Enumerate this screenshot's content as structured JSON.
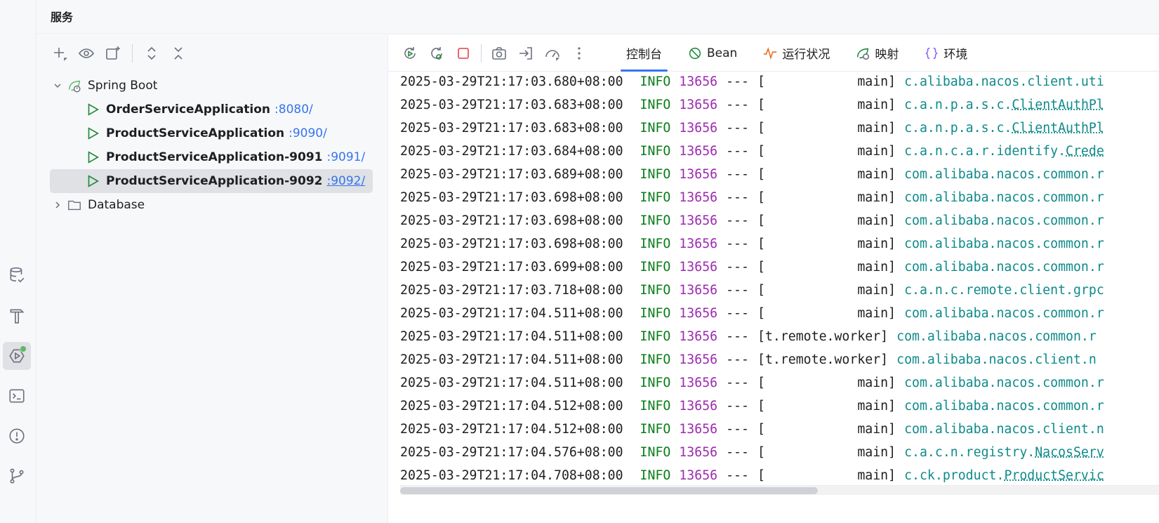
{
  "header": {
    "title": "服务"
  },
  "strip": {
    "icons": [
      "database-check-icon",
      "build-hammer-icon",
      "services-icon",
      "terminal-icon",
      "problems-icon",
      "git-branch-icon"
    ]
  },
  "tree_toolbar": {
    "icons": [
      "add-icon",
      "eye-icon",
      "new-group-icon",
      "expand-all-icon",
      "collapse-all-icon"
    ]
  },
  "tree": {
    "spring_boot": {
      "label": "Spring Boot"
    },
    "apps": [
      {
        "name": "OrderServiceApplication",
        "port": ":8080/"
      },
      {
        "name": "ProductServiceApplication",
        "port": ":9090/"
      },
      {
        "name": "ProductServiceApplication-9091",
        "port": ":9091/"
      },
      {
        "name": "ProductServiceApplication-9092",
        "port": ":9092/"
      }
    ],
    "database": {
      "label": "Database"
    }
  },
  "console_toolbar": {
    "icons": [
      "rerun-icon",
      "rerun-debug-icon",
      "stop-icon",
      "screenshot-icon",
      "attach-icon",
      "profiler-icon",
      "more-vertical-icon"
    ]
  },
  "tabs": [
    {
      "label": "控制台",
      "icon": ""
    },
    {
      "label": "Bean",
      "icon": "bean-icon"
    },
    {
      "label": "运行状况",
      "icon": "health-icon"
    },
    {
      "label": "映射",
      "icon": "mapping-icon"
    },
    {
      "label": "环境",
      "icon": "environment-icon"
    }
  ],
  "log": {
    "level": "INFO",
    "pid": "13656",
    "separator": "---",
    "lines": [
      {
        "ts": "2025-03-29T21:17:03.680+08:00",
        "thread": "[            main]",
        "logger": "c.alibaba.nacos.client.uti",
        "link": ""
      },
      {
        "ts": "2025-03-29T21:17:03.683+08:00",
        "thread": "[            main]",
        "logger": "c.a.n.p.a.s.c.",
        "link": "ClientAuthPl"
      },
      {
        "ts": "2025-03-29T21:17:03.683+08:00",
        "thread": "[            main]",
        "logger": "c.a.n.p.a.s.c.",
        "link": "ClientAuthPl"
      },
      {
        "ts": "2025-03-29T21:17:03.684+08:00",
        "thread": "[            main]",
        "logger": "c.a.n.c.a.r.identify.",
        "link": "Crede"
      },
      {
        "ts": "2025-03-29T21:17:03.689+08:00",
        "thread": "[            main]",
        "logger": "com.alibaba.nacos.common.r",
        "link": ""
      },
      {
        "ts": "2025-03-29T21:17:03.698+08:00",
        "thread": "[            main]",
        "logger": "com.alibaba.nacos.common.r",
        "link": ""
      },
      {
        "ts": "2025-03-29T21:17:03.698+08:00",
        "thread": "[            main]",
        "logger": "com.alibaba.nacos.common.r",
        "link": ""
      },
      {
        "ts": "2025-03-29T21:17:03.698+08:00",
        "thread": "[            main]",
        "logger": "com.alibaba.nacos.common.r",
        "link": ""
      },
      {
        "ts": "2025-03-29T21:17:03.699+08:00",
        "thread": "[            main]",
        "logger": "com.alibaba.nacos.common.r",
        "link": ""
      },
      {
        "ts": "2025-03-29T21:17:03.718+08:00",
        "thread": "[            main]",
        "logger": "c.a.n.c.remote.client.grpc",
        "link": ""
      },
      {
        "ts": "2025-03-29T21:17:04.511+08:00",
        "thread": "[            main]",
        "logger": "com.alibaba.nacos.common.r",
        "link": ""
      },
      {
        "ts": "2025-03-29T21:17:04.511+08:00",
        "thread": "[t.remote.worker]",
        "logger": "com.alibaba.nacos.common.r",
        "link": ""
      },
      {
        "ts": "2025-03-29T21:17:04.511+08:00",
        "thread": "[t.remote.worker]",
        "logger": "com.alibaba.nacos.client.n",
        "link": ""
      },
      {
        "ts": "2025-03-29T21:17:04.511+08:00",
        "thread": "[            main]",
        "logger": "com.alibaba.nacos.common.r",
        "link": ""
      },
      {
        "ts": "2025-03-29T21:17:04.512+08:00",
        "thread": "[            main]",
        "logger": "com.alibaba.nacos.common.r",
        "link": ""
      },
      {
        "ts": "2025-03-29T21:17:04.512+08:00",
        "thread": "[            main]",
        "logger": "com.alibaba.nacos.client.n",
        "link": ""
      },
      {
        "ts": "2025-03-29T21:17:04.576+08:00",
        "thread": "[            main]",
        "logger": "c.a.c.n.registry.",
        "link": "NacosServ"
      },
      {
        "ts": "2025-03-29T21:17:04.708+08:00",
        "thread": "[            main]",
        "logger": "c.ck.product.",
        "link": "ProductServic"
      }
    ]
  },
  "colors": {
    "accent": "#3574f0",
    "info": "#067d17",
    "pid": "#9d2bb0",
    "logger": "#0f8a8a",
    "stop": "#e55765",
    "green": "#5fb865"
  }
}
